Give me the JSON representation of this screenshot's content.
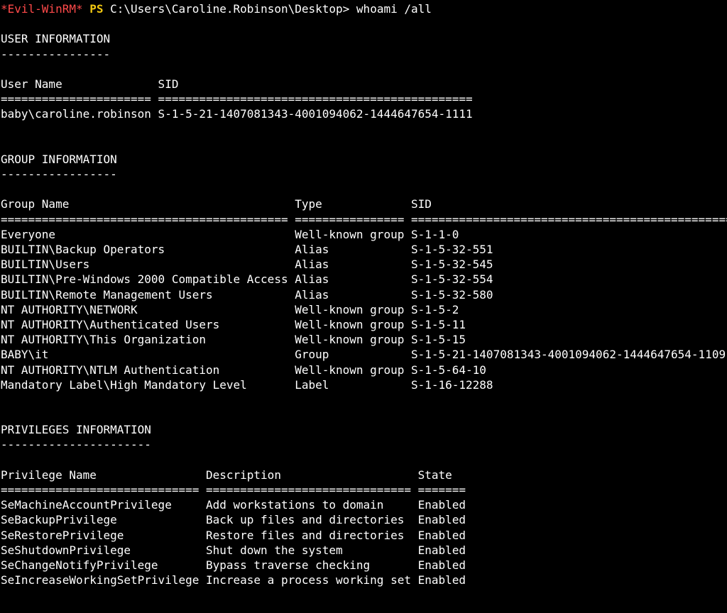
{
  "colors": {
    "background": "#000000",
    "text": "#ffffff",
    "prompt_tag": "#ff4a4a",
    "prompt_ps": "#f2c811"
  },
  "prompt": {
    "tag": "*Evil-WinRM*",
    "shell": "PS",
    "path_and_command": "C:\\Users\\Caroline.Robinson\\Desktop> whoami /all"
  },
  "user_section": {
    "title": "USER INFORMATION",
    "underline": "----------------",
    "header": "User Name              SID",
    "separator": "====================== ==============================================",
    "rows": [
      "baby\\caroline.robinson S-1-5-21-1407081343-4001094062-1444647654-1111"
    ]
  },
  "group_section": {
    "title": "GROUP INFORMATION",
    "underline": "-----------------",
    "header": "Group Name                                 Type             SID",
    "separator": "========================================== ================ ===============================================",
    "rows": [
      "Everyone                                   Well-known group S-1-1-0",
      "BUILTIN\\Backup Operators                   Alias            S-1-5-32-551",
      "BUILTIN\\Users                              Alias            S-1-5-32-545",
      "BUILTIN\\Pre-Windows 2000 Compatible Access Alias            S-1-5-32-554",
      "BUILTIN\\Remote Management Users            Alias            S-1-5-32-580",
      "NT AUTHORITY\\NETWORK                       Well-known group S-1-5-2",
      "NT AUTHORITY\\Authenticated Users           Well-known group S-1-5-11",
      "NT AUTHORITY\\This Organization             Well-known group S-1-5-15",
      "BABY\\it                                    Group            S-1-5-21-1407081343-4001094062-1444647654-1109",
      "NT AUTHORITY\\NTLM Authentication           Well-known group S-1-5-64-10",
      "Mandatory Label\\High Mandatory Level       Label            S-1-16-12288"
    ]
  },
  "privileges_section": {
    "title": "PRIVILEGES INFORMATION",
    "underline": "----------------------",
    "header": "Privilege Name                Description                    State",
    "separator": "============================= ============================== =======",
    "rows": [
      "SeMachineAccountPrivilege     Add workstations to domain     Enabled",
      "SeBackupPrivilege             Back up files and directories  Enabled",
      "SeRestorePrivilege            Restore files and directories  Enabled",
      "SeShutdownPrivilege           Shut down the system           Enabled",
      "SeChangeNotifyPrivilege       Bypass traverse checking       Enabled",
      "SeIncreaseWorkingSetPrivilege Increase a process working set Enabled"
    ]
  }
}
